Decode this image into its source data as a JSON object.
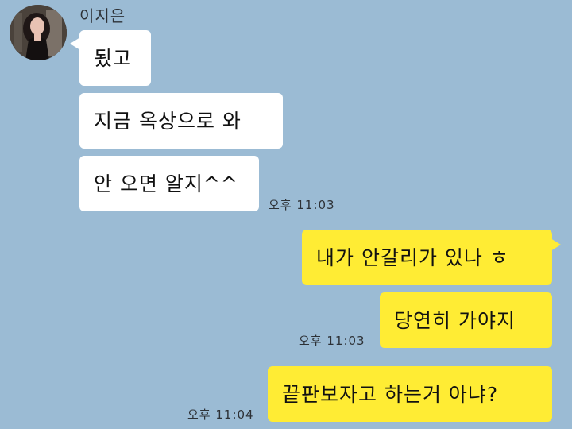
{
  "contact": {
    "name": "이지은"
  },
  "messages": [
    {
      "text": "됬고"
    },
    {
      "text": "지금 옥상으로 와"
    },
    {
      "text": "안 오면 알지^^",
      "time": "오후 11:03"
    },
    {
      "text": "내가 안갈리가 있나 ㅎ"
    },
    {
      "text": "당연히 가야지",
      "time": "오후 11:03"
    },
    {
      "text": "끝판보자고 하는거 아냐?",
      "time": "오후 11:04"
    }
  ],
  "colors": {
    "background": "#9bbbd4",
    "incoming_bubble": "#ffffff",
    "outgoing_bubble": "#ffec34"
  }
}
